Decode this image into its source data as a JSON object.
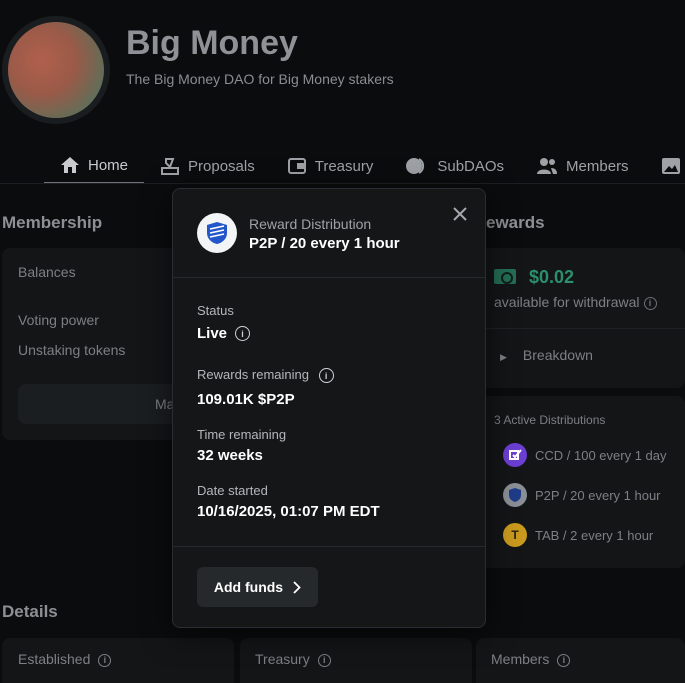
{
  "dao": {
    "name": "Big Money",
    "description": "The Big Money DAO for Big Money stakers"
  },
  "nav": {
    "tabs": [
      {
        "label": "Home",
        "icon": "home-icon"
      },
      {
        "label": "Proposals",
        "icon": "proposals-icon"
      },
      {
        "label": "Treasury",
        "icon": "treasury-icon"
      },
      {
        "label": "SubDAOs",
        "icon": "subdaos-icon"
      },
      {
        "label": "Members",
        "icon": "members-icon"
      },
      {
        "label": "",
        "icon": "image-icon"
      }
    ],
    "active": "Home"
  },
  "membership": {
    "title": "Membership",
    "balances_label": "Balances",
    "voting_power_label": "Voting power",
    "unstaking_label": "Unstaking tokens",
    "manage_button_partial": "Ma"
  },
  "rewards": {
    "title_partial": "ewards",
    "amount": "$0.02",
    "amount_caption": "available for withdrawal",
    "breakdown_label": "Breakdown",
    "active_distributions_label": "3 Active Distributions",
    "distributions": [
      {
        "label": "CCD / 100 every 1 day",
        "token_icon": "ccd-token-icon",
        "color": "#6b3fd1"
      },
      {
        "label": "P2P / 20 every 1 hour",
        "token_icon": "p2p-token-icon",
        "color": "#8a8f95"
      },
      {
        "label": "TAB / 2 every 1 hour",
        "token_icon": "tab-token-icon",
        "color": "#c99a1e"
      }
    ]
  },
  "details": {
    "title": "Details",
    "cards": [
      {
        "label": "Established"
      },
      {
        "label": "Treasury"
      },
      {
        "label": "Members"
      }
    ]
  },
  "modal": {
    "kicker": "Reward Distribution",
    "title": "P2P / 20 every 1 hour",
    "status_label": "Status",
    "status_value": "Live",
    "rewards_remaining_label": "Rewards remaining",
    "rewards_remaining_value": "109.01K $P2P",
    "time_remaining_label": "Time remaining",
    "time_remaining_value": "32 weeks",
    "date_started_label": "Date started",
    "date_started_value": "10/16/2025, 01:07 PM EDT",
    "add_funds_label": "Add funds",
    "token_color": "#2256c9"
  }
}
